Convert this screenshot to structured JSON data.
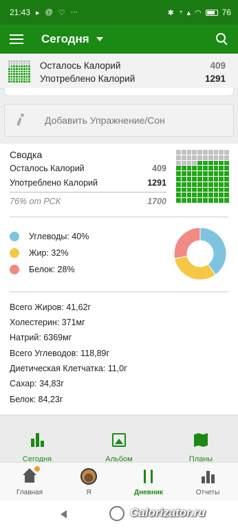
{
  "status_bar": {
    "time": "21:43",
    "battery": "76"
  },
  "app_bar": {
    "title": "Сегодня"
  },
  "summary_top": {
    "remaining_label": "Осталось Калорий",
    "remaining_value": "409",
    "consumed_label": "Употреблено Калорий",
    "consumed_value": "1291"
  },
  "add_exercise": {
    "label": "Добавить Упражнение/Сон"
  },
  "summary": {
    "title": "Сводка",
    "remaining_label": "Осталось Калорий",
    "remaining_value": "409",
    "consumed_label": "Употреблено Калорий",
    "consumed_value": "1291",
    "rsk_label": "76% от РСК",
    "rsk_value": "1700"
  },
  "macros": [
    {
      "label": "Углеводы: 40%",
      "percent": 40,
      "color": "#7ec4df"
    },
    {
      "label": "Жир: 32%",
      "percent": 32,
      "color": "#f5c744"
    },
    {
      "label": "Белок: 28%",
      "percent": 28,
      "color": "#f08a84"
    }
  ],
  "nutrients": [
    "Всего Жиров: 41,62г",
    "Холестерин: 371мг",
    "Натрий: 6369мг",
    "Всего Углеводов: 118,89г",
    "Диетическая Клетчатка: 11,0г",
    "Сахар: 34,83г",
    "Белок: 84,23г"
  ],
  "sub_nav": {
    "today": "Сегодня",
    "album": "Альбом",
    "plans": "Планы"
  },
  "bottom_nav": {
    "home": "Главная",
    "me": "Я",
    "diary": "Дневник",
    "reports": "Отчеты"
  },
  "watermark": "Calorizator.ru",
  "colors": {
    "brand": "#1b8a14",
    "grid_fill": "#24a51a",
    "grid_empty": "#c2c2c2"
  },
  "calorie_progress_fraction": 0.76
}
